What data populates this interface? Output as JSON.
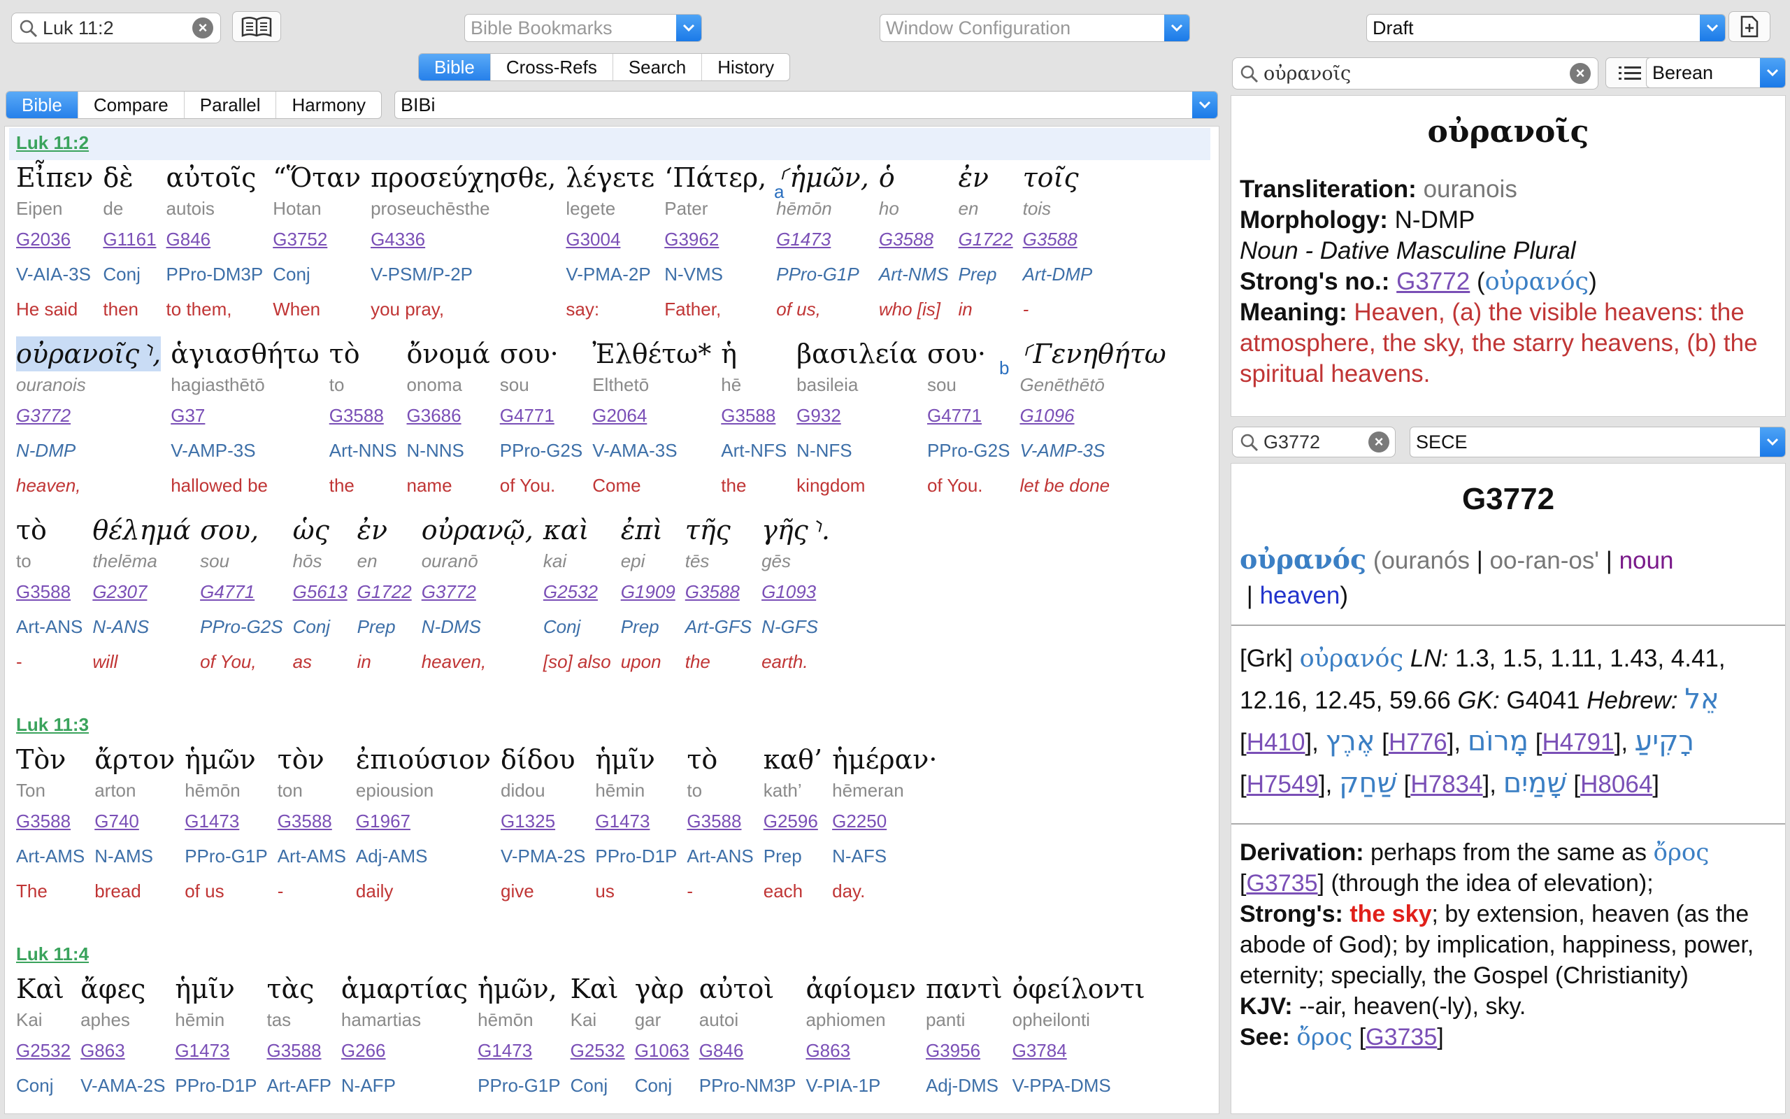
{
  "toolbar": {
    "reference_value": "Luk 11:2",
    "bookmarks_placeholder": "Bible Bookmarks",
    "window_config_placeholder": "Window Configuration",
    "draft_value": "Draft"
  },
  "main_tabs": [
    "Bible",
    "Cross-Refs",
    "Search",
    "History"
  ],
  "view_tabs": [
    "Bible",
    "Compare",
    "Parallel",
    "Harmony"
  ],
  "version": "BIBi",
  "verses": [
    {
      "ref": "Luk 11:2",
      "lines": [
        {
          "words": [
            {
              "g": "Εἶπεν",
              "t": "Eipen",
              "s": "G2036",
              "m": "V-AIA-3S",
              "e": "He said"
            },
            {
              "g": "δὲ",
              "t": "de",
              "s": "G1161",
              "m": "Conj",
              "e": "then"
            },
            {
              "g": "αὐτοῖς",
              "t": "autois",
              "s": "G846",
              "m": "PPro-DM3P",
              "e": "to them,"
            },
            {
              "g": "“Ὅταν",
              "t": "Hotan",
              "s": "G3752",
              "m": "Conj",
              "e": "When"
            },
            {
              "g": "προσεύχησθε,",
              "t": "proseuchēsthe",
              "s": "G4336",
              "m": "V-PSM/P-2P",
              "e": "you pray,"
            },
            {
              "g": "λέγετε",
              "t": "legete",
              "s": "G3004",
              "m": "V-PMA-2P",
              "e": "say:"
            },
            {
              "g": "‘Πάτερ,",
              "t": "Pater",
              "s": "G3962",
              "m": "N-VMS",
              "e": "Father,"
            },
            {
              "g": "⸂ἡμῶν,",
              "t": "hēmōn",
              "s": "G1473",
              "m": "PPro-G1P",
              "e": "of us,",
              "it": true
            },
            {
              "g": "ὁ",
              "t": "ho",
              "s": "G3588",
              "m": "Art-NMS",
              "e": "who [is]",
              "it": true
            },
            {
              "g": "ἐν",
              "t": "en",
              "s": "G1722",
              "m": "Prep",
              "e": "in",
              "it": true
            },
            {
              "g": "τοῖς",
              "t": "tois",
              "s": "G3588",
              "m": "Art-DMP",
              "e": "-",
              "it": true
            }
          ]
        },
        {
          "words": [
            {
              "g": "οὐρανοῖς⸃,",
              "t": "ouranois",
              "s": "G3772",
              "m": "N-DMP",
              "e": "heaven,",
              "it": true
            },
            {
              "g": "ἁγιασθήτω",
              "t": "hagiasthētō",
              "s": "G37",
              "m": "V-AMP-3S",
              "e": "hallowed be"
            },
            {
              "g": "τὸ",
              "t": "to",
              "s": "G3588",
              "m": "Art-NNS",
              "e": "the"
            },
            {
              "g": "ὄνομά",
              "t": "onoma",
              "s": "G3686",
              "m": "N-NNS",
              "e": "name"
            },
            {
              "g": "σου·",
              "t": "sou",
              "s": "G4771",
              "m": "PPro-G2S",
              "e": "of You."
            },
            {
              "g": "Ἐλθέτω*",
              "t": "Elthetō",
              "s": "G2064",
              "m": "V-AMA-3S",
              "e": "Come"
            },
            {
              "g": "ἡ",
              "t": "hē",
              "s": "G3588",
              "m": "Art-NFS",
              "e": "the"
            },
            {
              "g": "βασιλεία",
              "t": "basileia",
              "s": "G932",
              "m": "N-NFS",
              "e": "kingdom"
            },
            {
              "g": "σου·",
              "t": "sou",
              "s": "G4771",
              "m": "PPro-G2S",
              "e": "of You."
            },
            {
              "g": "⸂Γενηθήτω",
              "t": "Genēthētō",
              "s": "G1096",
              "m": "V-AMP-3S",
              "e": "let be done",
              "it": true
            }
          ]
        },
        {
          "words": [
            {
              "g": "τὸ",
              "t": "to",
              "s": "G3588",
              "m": "Art-ANS",
              "e": "-"
            },
            {
              "g": "θέλημά",
              "t": "thelēma",
              "s": "G2307",
              "m": "N-ANS",
              "e": "will",
              "it": true
            },
            {
              "g": "σου,",
              "t": "sou",
              "s": "G4771",
              "m": "PPro-G2S",
              "e": "of You,",
              "it": true
            },
            {
              "g": "ὡς",
              "t": "hōs",
              "s": "G5613",
              "m": "Conj",
              "e": "as",
              "it": true
            },
            {
              "g": "ἐν",
              "t": "en",
              "s": "G1722",
              "m": "Prep",
              "e": "in",
              "it": true
            },
            {
              "g": "οὐρανῷ,",
              "t": "ouranō",
              "s": "G3772",
              "m": "N-DMS",
              "e": "heaven,",
              "it": true
            },
            {
              "g": "καὶ",
              "t": "kai",
              "s": "G2532",
              "m": "Conj",
              "e": "[so] also",
              "it": true
            },
            {
              "g": "ἐπὶ",
              "t": "epi",
              "s": "G1909",
              "m": "Prep",
              "e": "upon",
              "it": true
            },
            {
              "g": "τῆς",
              "t": "tēs",
              "s": "G3588",
              "m": "Art-GFS",
              "e": "the",
              "it": true
            },
            {
              "g": "γῆς⸃.",
              "t": "gēs",
              "s": "G1093",
              "m": "N-GFS",
              "e": "earth.",
              "it": true
            }
          ]
        }
      ]
    },
    {
      "ref": "Luk 11:3",
      "lines": [
        {
          "words": [
            {
              "g": "Τὸν",
              "t": "Ton",
              "s": "G3588",
              "m": "Art-AMS",
              "e": "The"
            },
            {
              "g": "ἄρτον",
              "t": "arton",
              "s": "G740",
              "m": "N-AMS",
              "e": "bread"
            },
            {
              "g": "ἡμῶν",
              "t": "hēmōn",
              "s": "G1473",
              "m": "PPro-G1P",
              "e": "of us"
            },
            {
              "g": "τὸν",
              "t": "ton",
              "s": "G3588",
              "m": "Art-AMS",
              "e": "-"
            },
            {
              "g": "ἐπιούσιον",
              "t": "epiousion",
              "s": "G1967",
              "m": "Adj-AMS",
              "e": "daily"
            },
            {
              "g": "δίδου",
              "t": "didou",
              "s": "G1325",
              "m": "V-PMA-2S",
              "e": "give"
            },
            {
              "g": "ἡμῖν",
              "t": "hēmin",
              "s": "G1473",
              "m": "PPro-D1P",
              "e": "us"
            },
            {
              "g": "τὸ",
              "t": "to",
              "s": "G3588",
              "m": "Art-ANS",
              "e": "-"
            },
            {
              "g": "καθ’",
              "t": "kath’",
              "s": "G2596",
              "m": "Prep",
              "e": "each"
            },
            {
              "g": "ἡμέραν·",
              "t": "hēmeran",
              "s": "G2250",
              "m": "N-AFS",
              "e": "day."
            }
          ]
        }
      ]
    },
    {
      "ref": "Luk 11:4",
      "lines": [
        {
          "words": [
            {
              "g": "Καὶ",
              "t": "Kai",
              "s": "G2532",
              "m": "Conj",
              "e": ""
            },
            {
              "g": "ἄφες",
              "t": "aphes",
              "s": "G863",
              "m": "V-AMA-2S",
              "e": ""
            },
            {
              "g": "ἡμῖν",
              "t": "hēmin",
              "s": "G1473",
              "m": "PPro-D1P",
              "e": ""
            },
            {
              "g": "τὰς",
              "t": "tas",
              "s": "G3588",
              "m": "Art-AFP",
              "e": ""
            },
            {
              "g": "ἁμαρτίας",
              "t": "hamartias",
              "s": "G266",
              "m": "N-AFP",
              "e": ""
            },
            {
              "g": "ἡμῶν,",
              "t": "hēmōn",
              "s": "G1473",
              "m": "PPro-G1P",
              "e": ""
            },
            {
              "g": "Καὶ",
              "t": "Kai",
              "s": "G2532",
              "m": "Conj",
              "e": ""
            },
            {
              "g": "γὰρ",
              "t": "gar",
              "s": "G1063",
              "m": "Conj",
              "e": ""
            },
            {
              "g": "αὐτοὶ",
              "t": "autoi",
              "s": "G846",
              "m": "PPro-NM3P",
              "e": ""
            },
            {
              "g": "ἀφίομεν",
              "t": "aphiomen",
              "s": "G863",
              "m": "V-PIA-1P",
              "e": ""
            },
            {
              "g": "παντὶ",
              "t": "panti",
              "s": "G3956",
              "m": "Adj-DMS",
              "e": ""
            },
            {
              "g": "ὀφείλοντι",
              "t": "opheilonti",
              "s": "G3784",
              "m": "V-PPA-DMS",
              "e": ""
            }
          ]
        }
      ]
    }
  ],
  "notes": [
    "a",
    "b"
  ],
  "lexicon_panel": {
    "search_value": "οὐρανοῖς",
    "source": "Berean",
    "headword": "οὐρανοῖς",
    "transliteration_label": "Transliteration:",
    "transliteration": "ouranois",
    "morphology_label": "Morphology:",
    "morphology": "N-DMP",
    "morph_desc": "Noun - Dative Masculine Plural",
    "strongs_label": "Strong's no.:",
    "strongs_no": "G3772",
    "strongs_greek": "οὐρανός",
    "meaning_label": "Meaning:",
    "meaning": "Heaven, (a) the visible heavens: the atmosphere, the sky, the starry heavens, (b) the spiritual heavens."
  },
  "dictionary_panel": {
    "search_value": "G3772",
    "source": "SECE",
    "title": "G3772",
    "lemma": "οὐρανός",
    "translit": "ouranós",
    "pronunciation": "oo-ran-os'",
    "pos": "noun",
    "gloss": "heaven",
    "grk_label": "[Grk]",
    "grk_word": "οὐρανός",
    "ln_label": "LN:",
    "ln_values": "1.3, 1.5, 1.11, 1.43, 4.41, 12.16, 12.45, 59.66",
    "gk_label": "GK:",
    "gk_value": "G4041",
    "hebrew_label": "Hebrew:",
    "hebrew": [
      {
        "word": "אֵל",
        "code": "H410"
      },
      {
        "word": "אֶרֶץ",
        "code": "H776"
      },
      {
        "word": "מָרוֹם",
        "code": "H4791"
      },
      {
        "word": "רָקִיעַ",
        "code": "H7549"
      },
      {
        "word": "שַׁחַק",
        "code": "H7834"
      },
      {
        "word": "שָׁמַיִם",
        "code": "H8064"
      }
    ],
    "derivation_label": "Derivation:",
    "derivation_pre": "perhaps from the same as",
    "derivation_word": "ὄρος",
    "derivation_code": "G3735",
    "derivation_post": "(through the idea of elevation);",
    "strongs_label": "Strong's:",
    "strongs_hl": "the sky",
    "strongs_text": "; by extension, heaven (as the abode of God); by implication, happiness, power, eternity; specially, the Gospel (Christianity)",
    "kjv_label": "KJV:",
    "kjv_text": "--air, heaven(-ly), sky.",
    "see_label": "See:",
    "see_word": "ὄρος",
    "see_code": "G3735"
  }
}
